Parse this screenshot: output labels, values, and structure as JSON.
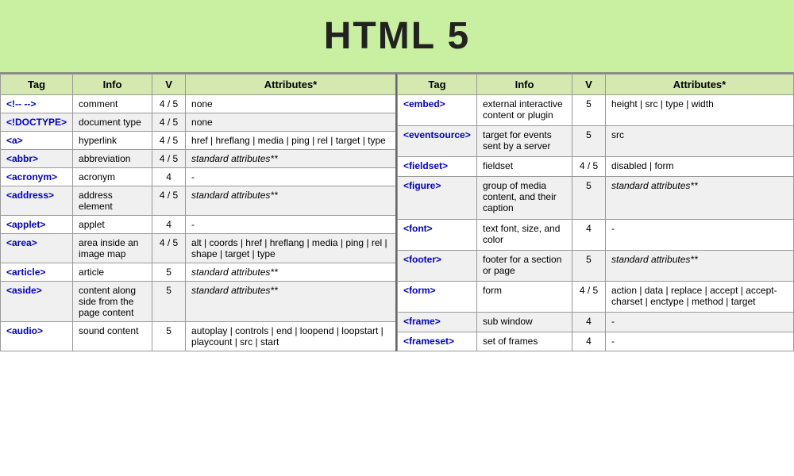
{
  "header": {
    "title": "HTML 5"
  },
  "left_table": {
    "columns": [
      "Tag",
      "Info",
      "V",
      "Attributes*"
    ],
    "rows": [
      {
        "tag": "<!-- -->",
        "info": "comment",
        "v": "4 / 5",
        "attr": "none",
        "attr_italic": false
      },
      {
        "tag": "<!DOCTYPE>",
        "info": "document type",
        "v": "4 / 5",
        "attr": "none",
        "attr_italic": false
      },
      {
        "tag": "<a>",
        "info": "hyperlink",
        "v": "4 / 5",
        "attr": "href | hreflang | media | ping | rel | target | type",
        "attr_italic": false
      },
      {
        "tag": "<abbr>",
        "info": "abbreviation",
        "v": "4 / 5",
        "attr": "standard attributes**",
        "attr_italic": true
      },
      {
        "tag": "<acronym>",
        "info": "acronym",
        "v": "4",
        "attr": "-",
        "attr_italic": false
      },
      {
        "tag": "<address>",
        "info": "address element",
        "v": "4 / 5",
        "attr": "standard attributes**",
        "attr_italic": true
      },
      {
        "tag": "<applet>",
        "info": "applet",
        "v": "4",
        "attr": "-",
        "attr_italic": false
      },
      {
        "tag": "<area>",
        "info": "area inside an image map",
        "v": "4 / 5",
        "attr": "alt | coords | href | hreflang | media | ping | rel | shape | target | type",
        "attr_italic": false
      },
      {
        "tag": "<article>",
        "info": "article",
        "v": "5",
        "attr": "standard attributes**",
        "attr_italic": true
      },
      {
        "tag": "<aside>",
        "info": "content along side from the page content",
        "v": "5",
        "attr": "standard attributes**",
        "attr_italic": true
      },
      {
        "tag": "<audio>",
        "info": "sound content",
        "v": "5",
        "attr": "autoplay | controls | end | loopend | loopstart | playcount | src | start",
        "attr_italic": false
      }
    ]
  },
  "right_table": {
    "columns": [
      "Tag",
      "Info",
      "V",
      "Attributes*"
    ],
    "rows": [
      {
        "tag": "<embed>",
        "info": "external interactive content or plugin",
        "v": "5",
        "attr": "height | src | type | width",
        "attr_italic": false
      },
      {
        "tag": "<eventsource>",
        "info": "target for events sent by a server",
        "v": "5",
        "attr": "src",
        "attr_italic": false
      },
      {
        "tag": "<fieldset>",
        "info": "fieldset",
        "v": "4 / 5",
        "attr": "disabled | form",
        "attr_italic": false
      },
      {
        "tag": "<figure>",
        "info": "group of media content, and their caption",
        "v": "5",
        "attr": "standard attributes**",
        "attr_italic": true
      },
      {
        "tag": "<font>",
        "info": "text font, size, and color",
        "v": "4",
        "attr": "-",
        "attr_italic": false
      },
      {
        "tag": "<footer>",
        "info": "footer for a section or page",
        "v": "5",
        "attr": "standard attributes**",
        "attr_italic": true
      },
      {
        "tag": "<form>",
        "info": "form",
        "v": "4 / 5",
        "attr": "action | data | replace | accept | accept-charset | enctype | method | target",
        "attr_italic": false
      },
      {
        "tag": "<frame>",
        "info": "sub window",
        "v": "4",
        "attr": "-",
        "attr_italic": false
      },
      {
        "tag": "<frameset>",
        "info": "set of frames",
        "v": "4",
        "attr": "-",
        "attr_italic": false
      }
    ]
  }
}
